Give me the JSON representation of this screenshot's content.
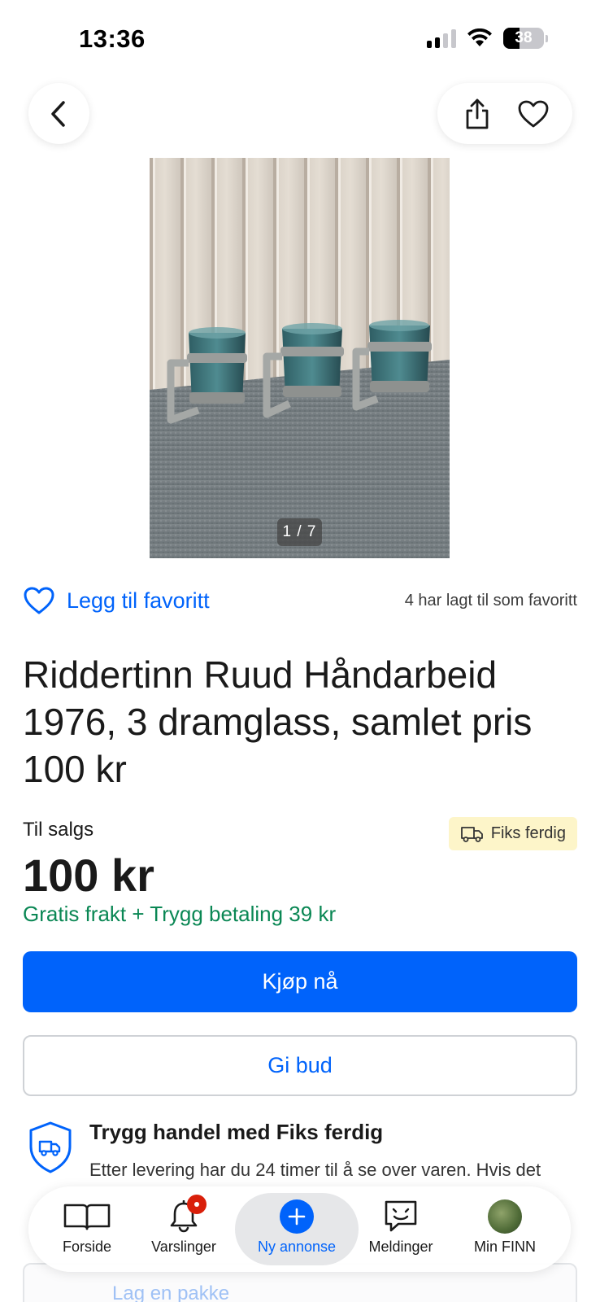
{
  "status_bar": {
    "time": "13:36",
    "battery": "38"
  },
  "image": {
    "counter": "1 / 7"
  },
  "favorite": {
    "link_label": "Legg til favoritt",
    "count_text": "4 har lagt til som favoritt"
  },
  "listing": {
    "title": "Riddertinn Ruud Håndarbeid 1976, 3 dramglass, samlet pris 100 kr",
    "status": "Til salgs",
    "price": "100 kr",
    "badge": "Fiks ferdig",
    "shipping": "Gratis frakt + Trygg betaling 39 kr"
  },
  "actions": {
    "buy": "Kjøp nå",
    "bid": "Gi bud"
  },
  "safe_trade": {
    "title": "Trygg handel med Fiks ferdig",
    "text": "Etter levering har du 24 timer til å se over varen. Hvis det"
  },
  "package_card": {
    "label": "Lag en pakke"
  },
  "tabbar": {
    "items": [
      {
        "label": "Forside",
        "icon": "book-icon"
      },
      {
        "label": "Varslinger",
        "icon": "bell-icon"
      },
      {
        "label": "Ny annonse",
        "icon": "plus-icon"
      },
      {
        "label": "Meldinger",
        "icon": "chat-icon"
      },
      {
        "label": "Min FINN",
        "icon": "avatar"
      }
    ]
  },
  "colors": {
    "accent": "#0063fb",
    "success": "#0a8754",
    "badge_bg": "#fdf5c9",
    "notification": "#d91f0a"
  }
}
